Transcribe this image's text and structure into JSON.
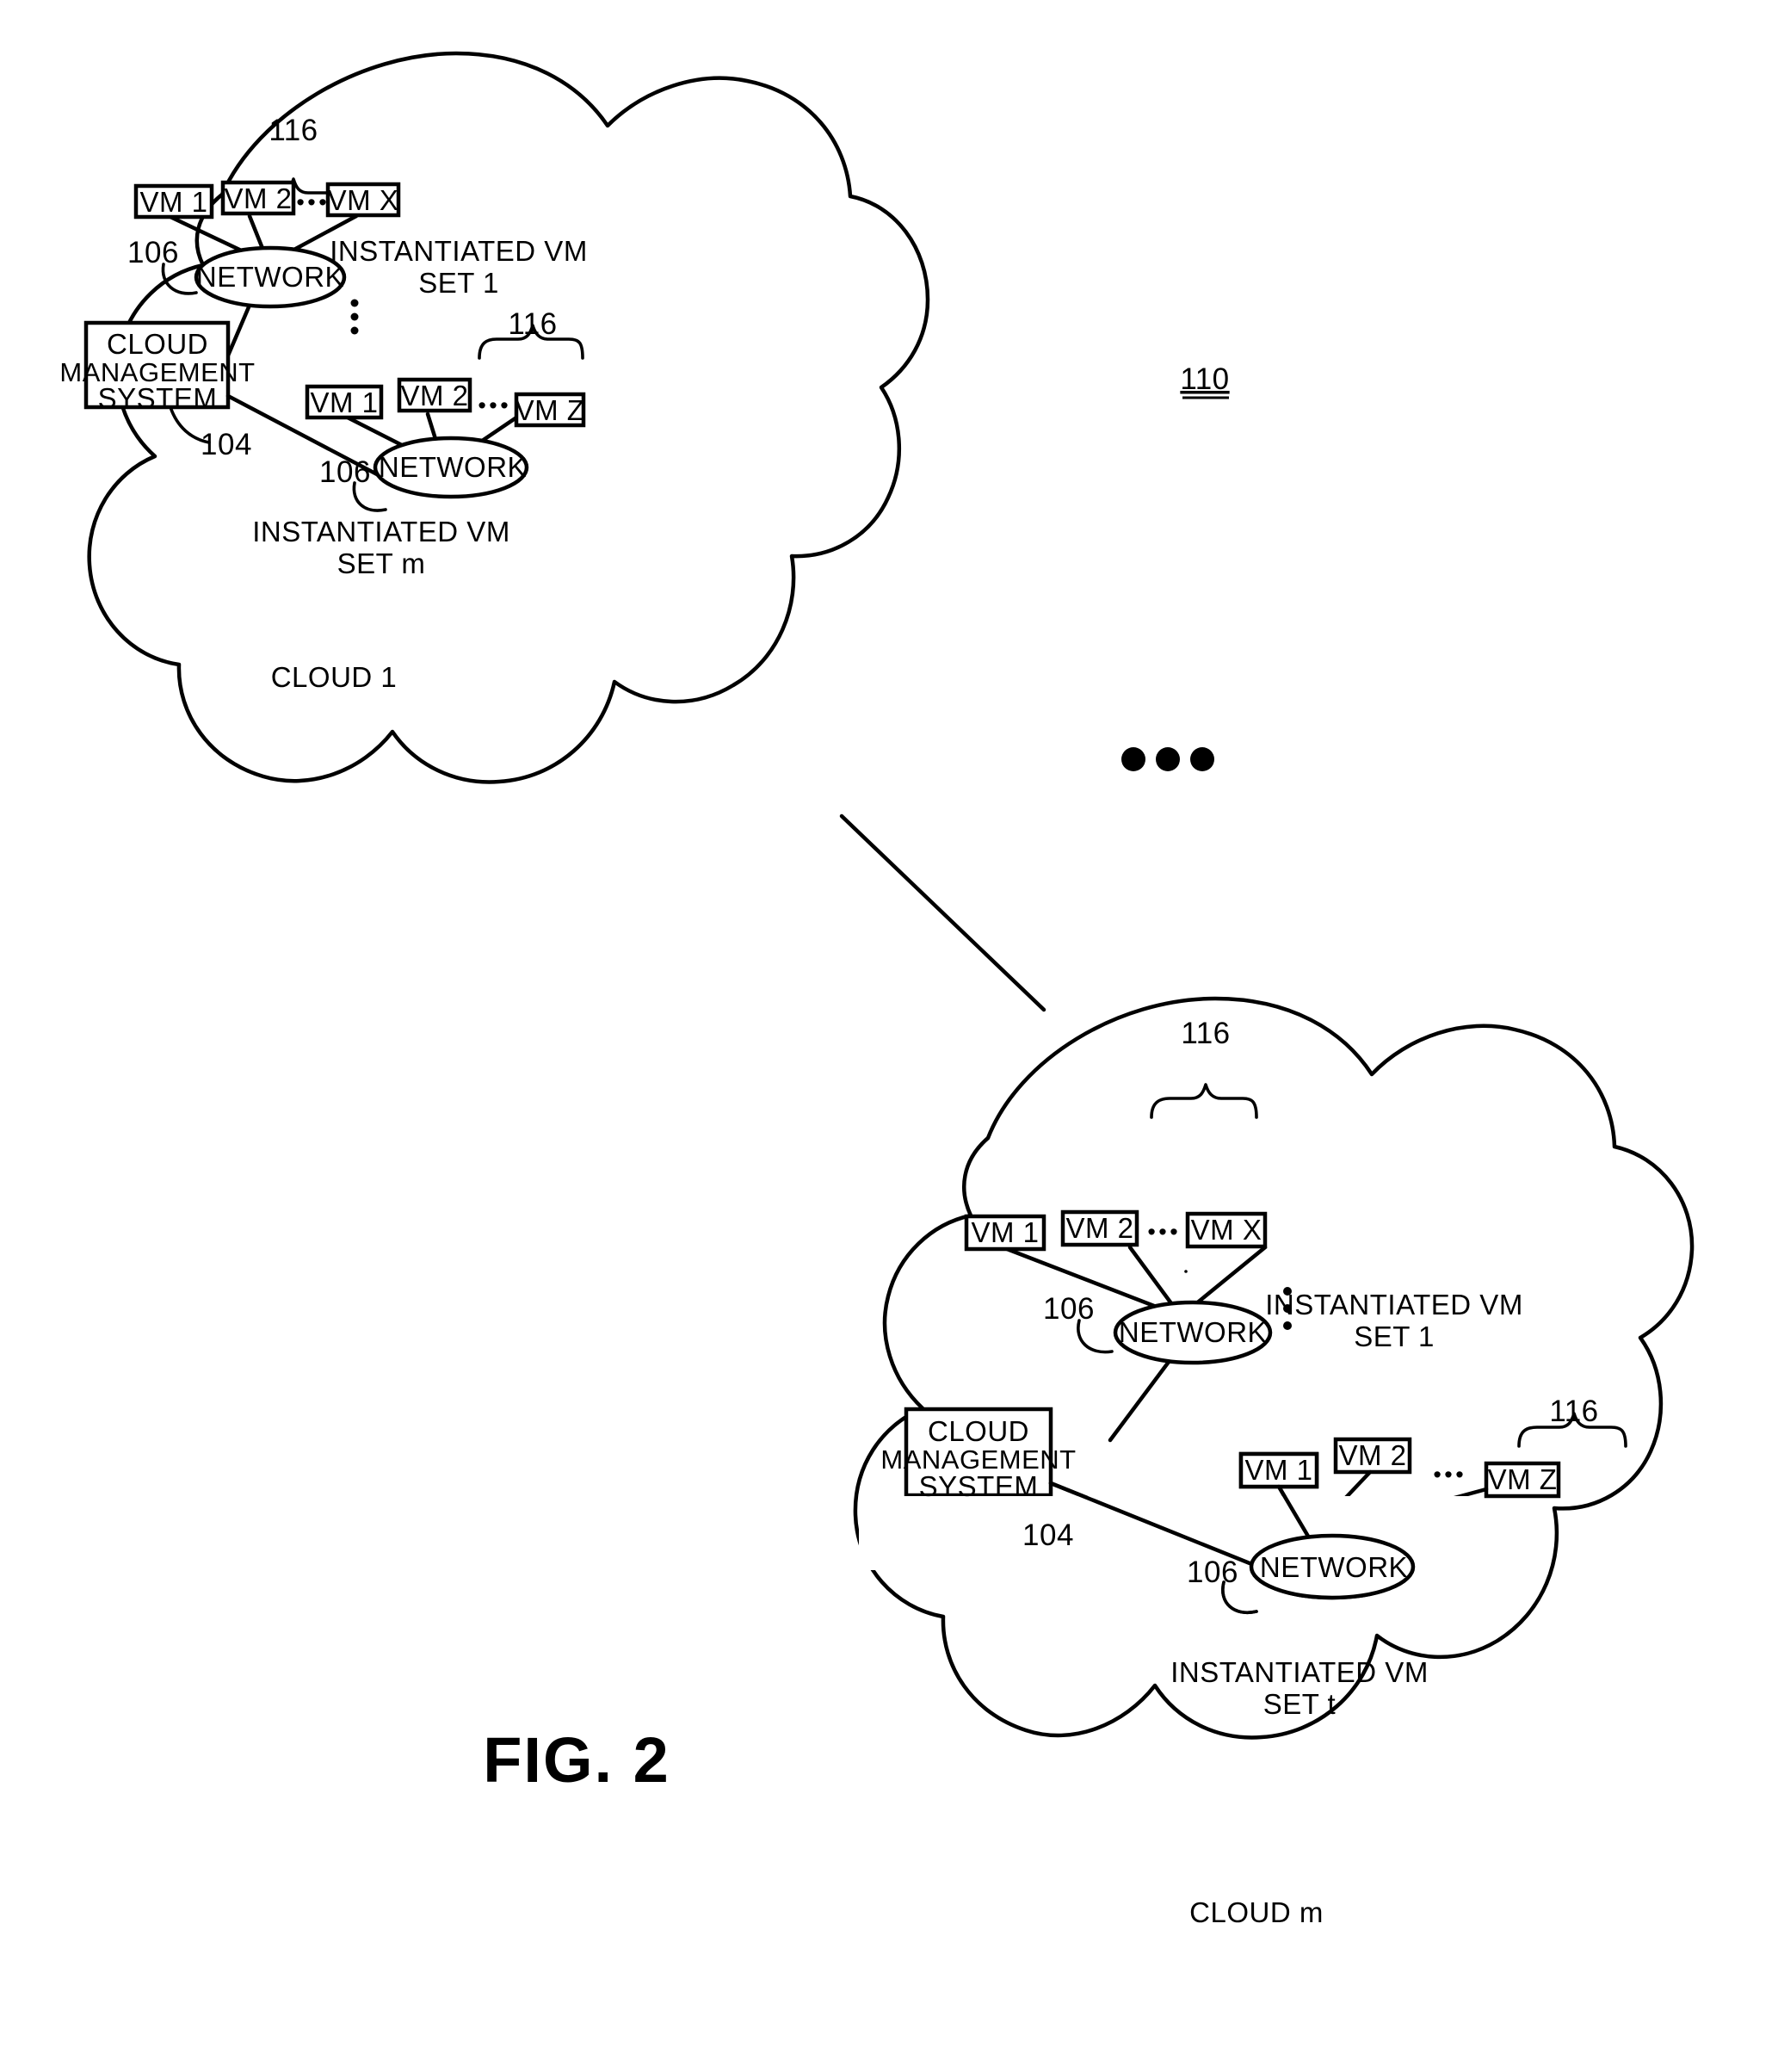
{
  "figure": {
    "label": "FIG. 2",
    "system_ref": "110"
  },
  "refs": {
    "cms": "104",
    "network": "106",
    "vm_set_bracket": "116",
    "system": "110"
  },
  "clouds": [
    {
      "name": "cloud-1",
      "caption": "CLOUD 1",
      "management_system": {
        "label_lines": [
          "CLOUD",
          "MANAGEMENT",
          "SYSTEM"
        ],
        "ref": "104"
      },
      "vm_sets": [
        {
          "set_label_lines": [
            "INSTANTIATED VM",
            "SET 1"
          ],
          "bracket_ref": "116",
          "network_label": "NETWORK",
          "network_ref": "106",
          "vms": [
            "VM 1",
            "VM 2",
            "VM X"
          ],
          "ellipsis": "• • •"
        },
        {
          "set_label_lines": [
            "INSTANTIATED VM",
            "SET m"
          ],
          "bracket_ref": "116",
          "network_label": "NETWORK",
          "network_ref": "106",
          "vms": [
            "VM 1",
            "VM 2",
            "VM Z"
          ],
          "ellipsis": "• • •"
        }
      ],
      "vertical_ellipsis": "⋮"
    },
    {
      "name": "cloud-m",
      "caption": "CLOUD m",
      "management_system": {
        "label_lines": [
          "CLOUD",
          "MANAGEMENT",
          "SYSTEM"
        ],
        "ref": "104"
      },
      "vm_sets": [
        {
          "set_label_lines": [
            "INSTANTIATED VM",
            "SET 1"
          ],
          "bracket_ref": "116",
          "network_label": "NETWORK",
          "network_ref": "106",
          "vms": [
            "VM 1",
            "VM 2",
            "VM X"
          ],
          "ellipsis": "• • •"
        },
        {
          "set_label_lines": [
            "INSTANTIATED VM",
            "SET t"
          ],
          "bracket_ref": "116",
          "network_label": "NETWORK",
          "network_ref": "106",
          "vms": [
            "VM 1",
            "VM 2",
            "VM Z"
          ],
          "ellipsis": "• • •"
        }
      ],
      "vertical_ellipsis": "⋮"
    }
  ],
  "between_clouds_ellipsis": "• • •"
}
